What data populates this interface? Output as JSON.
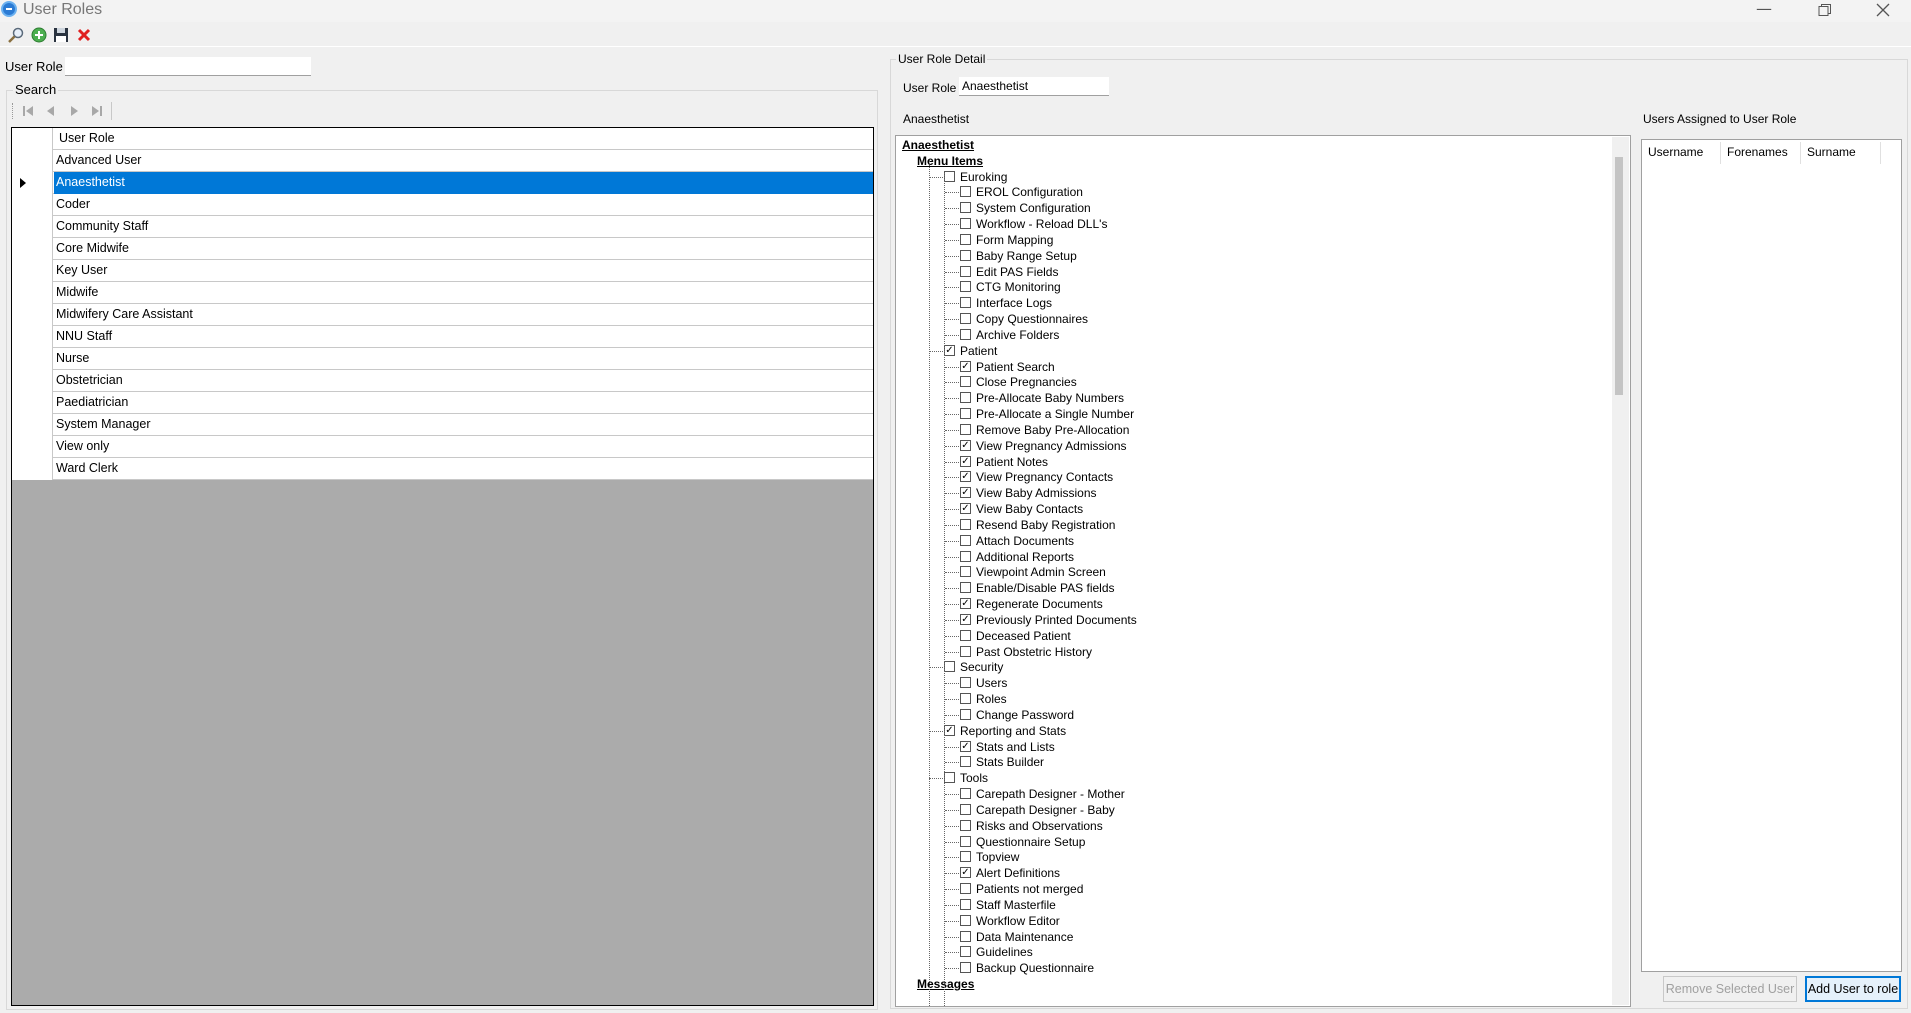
{
  "window": {
    "title": "User Roles",
    "controls": [
      "minimize-icon",
      "restore-icon",
      "close-icon"
    ]
  },
  "toolbar": {
    "icons": [
      "search-icon",
      "add-icon",
      "save-icon",
      "delete-icon"
    ]
  },
  "filter": {
    "user_role_label": "User Role",
    "user_role_value": ""
  },
  "search": {
    "group_label": "Search",
    "nav_icons": [
      "first-record-icon",
      "previous-record-icon",
      "next-record-icon",
      "last-record-icon"
    ],
    "column_header": "User Role",
    "selected_index": 1,
    "rows": [
      "Advanced User",
      "Anaesthetist",
      "Coder",
      "Community Staff",
      "Core Midwife",
      "Key User",
      "Midwife",
      "Midwifery Care Assistant",
      "NNU Staff",
      "Nurse",
      "Obstetrician",
      "Paediatrician",
      "System Manager",
      "View only",
      "Ward Clerk"
    ]
  },
  "detail": {
    "group_label": "User Role Detail",
    "user_role_label": "User Role",
    "user_role_value": "Anaesthetist",
    "tree_caption": "Anaesthetist",
    "tree": [
      {
        "label": "Anaesthetist",
        "level": 0,
        "header": true
      },
      {
        "label": "Menu Items",
        "level": 1,
        "header": true
      },
      {
        "label": "Euroking",
        "level": 2,
        "checked": false
      },
      {
        "label": "EROL Configuration",
        "level": 3,
        "checked": false
      },
      {
        "label": "System Configuration",
        "level": 3,
        "checked": false
      },
      {
        "label": "Workflow - Reload DLL's",
        "level": 3,
        "checked": false
      },
      {
        "label": "Form Mapping",
        "level": 3,
        "checked": false
      },
      {
        "label": "Baby Range Setup",
        "level": 3,
        "checked": false
      },
      {
        "label": "Edit PAS Fields",
        "level": 3,
        "checked": false
      },
      {
        "label": "CTG Monitoring",
        "level": 3,
        "checked": false
      },
      {
        "label": "Interface Logs",
        "level": 3,
        "checked": false
      },
      {
        "label": "Copy Questionnaires",
        "level": 3,
        "checked": false
      },
      {
        "label": "Archive Folders",
        "level": 3,
        "checked": false
      },
      {
        "label": "Patient",
        "level": 2,
        "checked": true
      },
      {
        "label": "Patient Search",
        "level": 3,
        "checked": true
      },
      {
        "label": "Close Pregnancies",
        "level": 3,
        "checked": false
      },
      {
        "label": "Pre-Allocate Baby Numbers",
        "level": 3,
        "checked": false
      },
      {
        "label": "Pre-Allocate a Single Number",
        "level": 3,
        "checked": false
      },
      {
        "label": "Remove Baby Pre-Allocation",
        "level": 3,
        "checked": false
      },
      {
        "label": "View Pregnancy Admissions",
        "level": 3,
        "checked": true
      },
      {
        "label": "Patient Notes",
        "level": 3,
        "checked": true
      },
      {
        "label": "View Pregnancy Contacts",
        "level": 3,
        "checked": true
      },
      {
        "label": "View Baby Admissions",
        "level": 3,
        "checked": true
      },
      {
        "label": "View Baby Contacts",
        "level": 3,
        "checked": true
      },
      {
        "label": "Resend Baby Registration",
        "level": 3,
        "checked": false
      },
      {
        "label": "Attach Documents",
        "level": 3,
        "checked": false
      },
      {
        "label": "Additional Reports",
        "level": 3,
        "checked": false
      },
      {
        "label": "Viewpoint Admin Screen",
        "level": 3,
        "checked": false
      },
      {
        "label": "Enable/Disable PAS fields",
        "level": 3,
        "checked": false
      },
      {
        "label": "Regenerate Documents",
        "level": 3,
        "checked": true
      },
      {
        "label": "Previously Printed Documents",
        "level": 3,
        "checked": true
      },
      {
        "label": "Deceased Patient",
        "level": 3,
        "checked": false
      },
      {
        "label": "Past Obstetric History",
        "level": 3,
        "checked": false
      },
      {
        "label": "Security",
        "level": 2,
        "checked": false
      },
      {
        "label": "Users",
        "level": 3,
        "checked": false
      },
      {
        "label": "Roles",
        "level": 3,
        "checked": false
      },
      {
        "label": "Change Password",
        "level": 3,
        "checked": false
      },
      {
        "label": "Reporting  and  Stats",
        "level": 2,
        "checked": true
      },
      {
        "label": "Stats and Lists",
        "level": 3,
        "checked": true
      },
      {
        "label": "Stats Builder",
        "level": 3,
        "checked": false
      },
      {
        "label": "Tools",
        "level": 2,
        "checked": false
      },
      {
        "label": "Carepath Designer - Mother",
        "level": 3,
        "checked": false
      },
      {
        "label": "Carepath Designer - Baby",
        "level": 3,
        "checked": false
      },
      {
        "label": "Risks and Observations",
        "level": 3,
        "checked": false
      },
      {
        "label": "Questionnaire Setup",
        "level": 3,
        "checked": false
      },
      {
        "label": "Topview",
        "level": 3,
        "checked": false
      },
      {
        "label": "Alert Definitions",
        "level": 3,
        "checked": true
      },
      {
        "label": "Patients not merged",
        "level": 3,
        "checked": false
      },
      {
        "label": "Staff Masterfile",
        "level": 3,
        "checked": false
      },
      {
        "label": "Workflow Editor",
        "level": 3,
        "checked": false
      },
      {
        "label": "Data Maintenance",
        "level": 3,
        "checked": false
      },
      {
        "label": "Guidelines",
        "level": 3,
        "checked": false
      },
      {
        "label": "Backup Questionnaire",
        "level": 3,
        "checked": false
      },
      {
        "label": "Messages",
        "level": 1,
        "header": true
      }
    ]
  },
  "users": {
    "caption": "Users Assigned to User Role",
    "columns": [
      "Username",
      "Forenames",
      "Surname"
    ],
    "rows": [],
    "remove_button": "Remove Selected User",
    "add_button": "Add User to role"
  }
}
